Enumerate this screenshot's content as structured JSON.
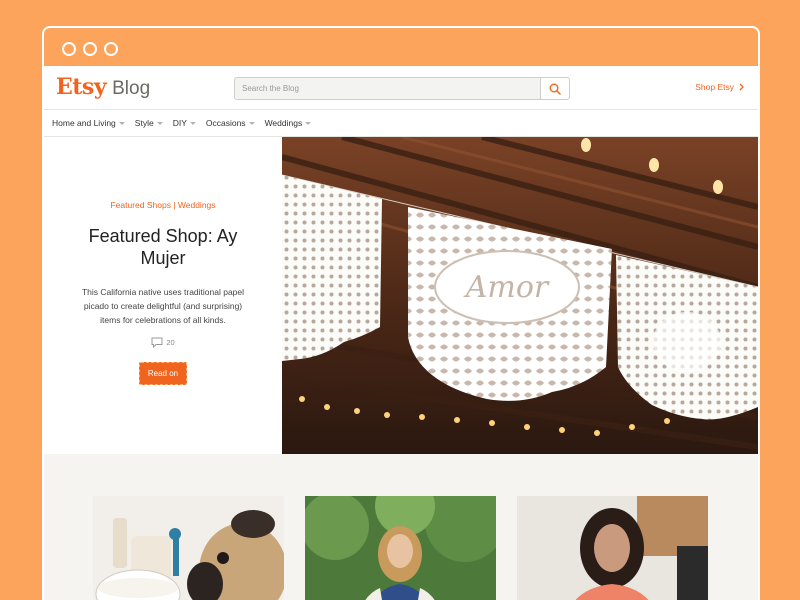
{
  "brand": {
    "logo_name": "Etsy",
    "section": "Blog",
    "accent_color": "#f1641e",
    "frame_color": "#fda45c"
  },
  "search": {
    "placeholder": "Search the Blog",
    "icon": "search-icon"
  },
  "header": {
    "shop_link": "Shop Etsy",
    "shop_link_icon": "chevron-right-icon"
  },
  "nav": {
    "items": [
      {
        "label": "Home and Living"
      },
      {
        "label": "Style"
      },
      {
        "label": "DIY"
      },
      {
        "label": "Occasions"
      },
      {
        "label": "Weddings"
      }
    ]
  },
  "hero": {
    "categories": "Featured Shops | Weddings",
    "title": "Featured Shop: Ay Mujer",
    "description": "This California native uses traditional papel picado to create delightful (and surprising) items for celebrations of all kinds.",
    "comment_count": "20",
    "comment_icon": "comment-icon",
    "cta": "Read on",
    "image_banner_text": "Amor"
  },
  "cards": [
    {
      "image": "pug-with-ceramic-bowl-photo"
    },
    {
      "image": "woman-in-garden-photo"
    },
    {
      "image": "woman-portrait-photo"
    }
  ]
}
